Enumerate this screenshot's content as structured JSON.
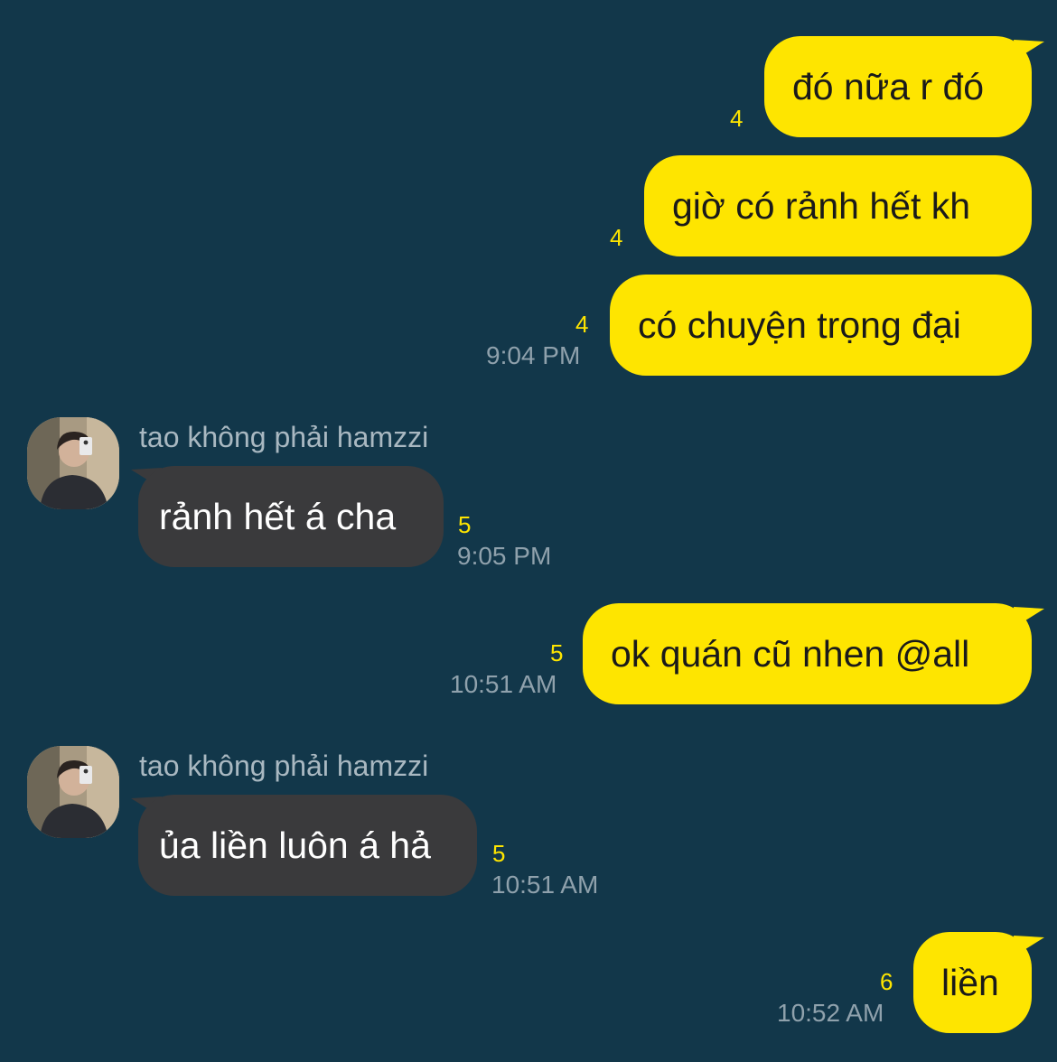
{
  "colors": {
    "background": "#12374A",
    "outgoing_bubble": "#FEE500",
    "incoming_bubble": "#3A3A3C",
    "unread_count": "#FEE500",
    "timestamp": "#8FA1AC",
    "sender_name": "#A9B8C1"
  },
  "messages": [
    {
      "direction": "out",
      "text": "đó nữa r đó",
      "unread": "4",
      "time": ""
    },
    {
      "direction": "out",
      "text": "giờ có rảnh hết kh",
      "unread": "4",
      "time": ""
    },
    {
      "direction": "out",
      "text": "có chuyện trọng đại",
      "unread": "4",
      "time": "9:04 PM"
    },
    {
      "direction": "in",
      "sender": "tao không phải hamzzi",
      "avatar_icon": "user-avatar",
      "text": "rảnh hết á cha",
      "unread": "5",
      "time": "9:05 PM"
    },
    {
      "direction": "out",
      "text": "ok quán cũ nhen @all",
      "unread": "5",
      "time": "10:51 AM"
    },
    {
      "direction": "in",
      "sender": "tao không phải hamzzi",
      "avatar_icon": "user-avatar",
      "text": "ủa liền luôn á hả",
      "unread": "5",
      "time": "10:51 AM"
    },
    {
      "direction": "out",
      "text": "liền",
      "unread": "6",
      "time": "10:52 AM"
    }
  ]
}
